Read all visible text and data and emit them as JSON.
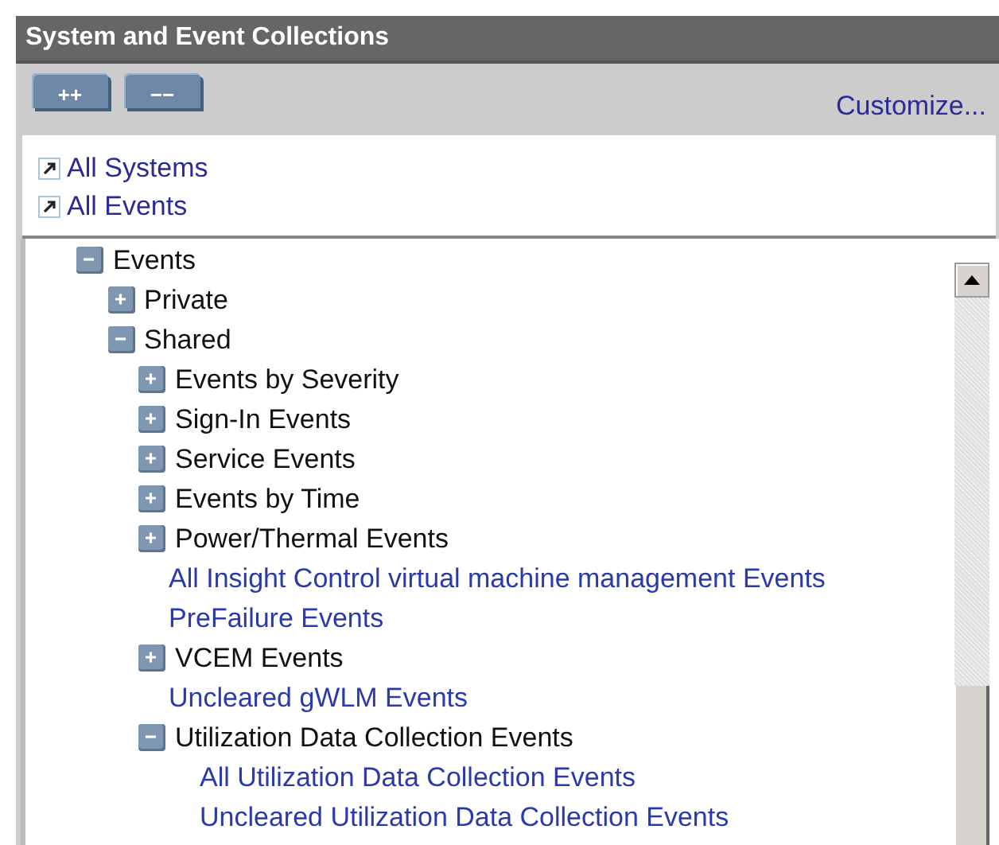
{
  "panel": {
    "title": "System and Event Collections"
  },
  "toolbar": {
    "buttons": [
      "++",
      "−−"
    ],
    "link": "Customize..."
  },
  "shortcuts": [
    "All Systems",
    "All Events"
  ],
  "tree": [
    {
      "kind": "folder",
      "label": "Events",
      "expanded": true,
      "children": [
        {
          "kind": "folder",
          "label": "Private",
          "expanded": false
        },
        {
          "kind": "folder",
          "label": "Shared",
          "expanded": true,
          "children": [
            {
              "kind": "folder",
              "label": "Events by Severity",
              "expanded": false
            },
            {
              "kind": "folder",
              "label": "Sign-In Events",
              "expanded": false
            },
            {
              "kind": "folder",
              "label": "Service Events",
              "expanded": false
            },
            {
              "kind": "folder",
              "label": "Events by Time",
              "expanded": false
            },
            {
              "kind": "folder",
              "label": "Power/Thermal Events",
              "expanded": false
            },
            {
              "kind": "link",
              "label": "All Insight Control virtual machine management Events"
            },
            {
              "kind": "link",
              "label": "PreFailure Events"
            },
            {
              "kind": "folder",
              "label": "VCEM Events",
              "expanded": false
            },
            {
              "kind": "link",
              "label": "Uncleared gWLM Events"
            },
            {
              "kind": "folder",
              "label": "Utilization Data Collection Events",
              "expanded": true,
              "children": [
                {
                  "kind": "link",
                  "label": "All Utilization Data Collection Events"
                },
                {
                  "kind": "link",
                  "label": "Uncleared Utilization Data Collection Events"
                }
              ]
            }
          ]
        }
      ]
    }
  ]
}
